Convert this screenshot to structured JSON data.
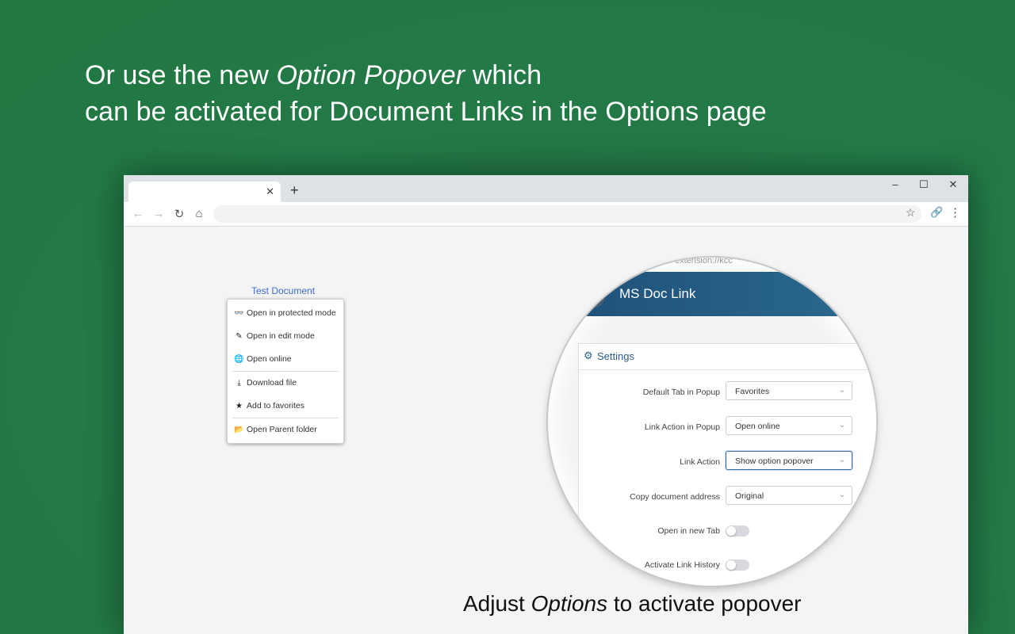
{
  "headline": {
    "line1_pre": "Or use the new ",
    "line1_em": "Option Popover",
    "line1_post": " which",
    "line2": "can be activated for Document Links in the Options page"
  },
  "browser": {
    "tab_close": "✕",
    "new_tab": "+",
    "window_controls": [
      "–",
      "☐",
      "✕"
    ],
    "nav": {
      "back": "←",
      "forward": "→",
      "reload": "↻",
      "home": "⌂"
    },
    "omnibox_value": "",
    "bookmark_icon": "☆",
    "extension_icon": "🔗",
    "menu_icon": "⋮"
  },
  "document_link": "Test Document",
  "popover": {
    "items": [
      {
        "icon": "glasses-icon",
        "glyph": "👓",
        "label": "Open in protected mode"
      },
      {
        "icon": "edit-icon",
        "glyph": "✎",
        "label": "Open in edit mode"
      },
      {
        "icon": "globe-icon",
        "glyph": "🌐",
        "label": "Open online"
      },
      {
        "icon": "download-icon",
        "glyph": "⤓",
        "label": "Download file"
      },
      {
        "icon": "star-icon",
        "glyph": "★",
        "label": "Add to favorites"
      },
      {
        "icon": "folder-open-icon",
        "glyph": "📂",
        "label": "Open Parent folder"
      }
    ]
  },
  "magnifier": {
    "url_fragment": "extension://kcc",
    "app_title": "MS Doc Link",
    "settings_title": "Settings",
    "rows": [
      {
        "label": "Default Tab in Popup",
        "value": "Favorites",
        "type": "select"
      },
      {
        "label": "Link Action in Popup",
        "value": "Open online",
        "type": "select"
      },
      {
        "label": "Link Action",
        "value": "Show option popover",
        "type": "select",
        "active": true
      },
      {
        "label": "Copy document address",
        "value": "Original",
        "type": "select"
      },
      {
        "label": "Open in new Tab",
        "value": false,
        "type": "toggle"
      },
      {
        "label": "Activate Link History",
        "value": false,
        "type": "toggle"
      }
    ]
  },
  "caption": {
    "pre": "Adjust ",
    "em": "Options",
    "post": " to activate popover"
  },
  "colors": {
    "background": "#237a47",
    "header_gradient": "#1f4f79",
    "link": "#3c6bc9"
  }
}
